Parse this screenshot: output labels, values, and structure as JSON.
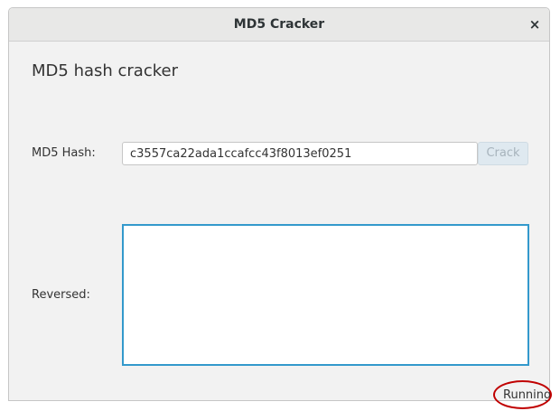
{
  "window": {
    "title": "MD5 Cracker",
    "close_glyph": "×"
  },
  "main": {
    "heading": "MD5 hash cracker",
    "hash_label": "MD5 Hash:",
    "hash_value": "c3557ca22ada1ccafcc43f8013ef0251",
    "crack_label": "Crack",
    "reversed_label": "Reversed:",
    "reversed_value": ""
  },
  "status": {
    "text": "Running",
    "highlight_color": "#c00000"
  },
  "colors": {
    "accent": "#3399cc",
    "disabled_button": "#dfe9f0"
  }
}
